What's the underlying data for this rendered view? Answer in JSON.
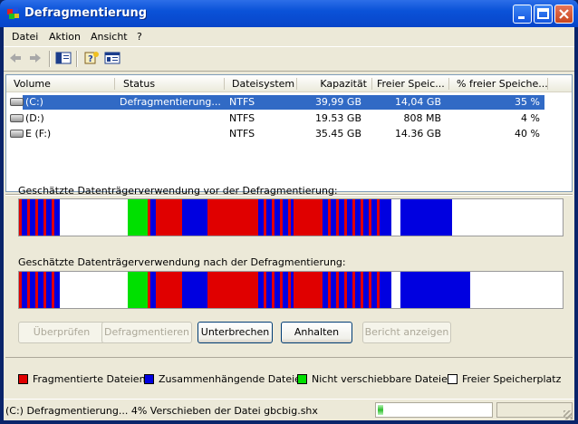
{
  "window": {
    "title": "Defragmentierung"
  },
  "menu": [
    "Datei",
    "Aktion",
    "Ansicht",
    "?"
  ],
  "volumes": {
    "headers": [
      "Volume",
      "Status",
      "Dateisystem",
      "Kapazität",
      "Freier Speic...",
      "% freier Speiche..."
    ],
    "rows": [
      {
        "volume": "(C:)",
        "status": "Defragmentierung...",
        "fs": "NTFS",
        "capacity": "39,99 GB",
        "free": "14,04 GB",
        "pct_free": "35 %",
        "selected": true
      },
      {
        "volume": "(D:)",
        "status": "",
        "fs": "NTFS",
        "capacity": "19.53 GB",
        "free": "808 MB",
        "pct_free": "4 %",
        "selected": false
      },
      {
        "volume": "E (F:)",
        "status": "",
        "fs": "NTFS",
        "capacity": "35.45 GB",
        "free": "14.36 GB",
        "pct_free": "40 %",
        "selected": false
      }
    ]
  },
  "analysis": {
    "before_label": "Geschätzte Datenträgerverwendung vor der Defragmentierung:",
    "after_label": "Geschätzte Datenträgerverwendung nach der Defragmentierung:",
    "before_segments": [
      {
        "start": 0.0,
        "end": 0.075,
        "kind": "mixed"
      },
      {
        "start": 0.075,
        "end": 0.2,
        "kind": "free"
      },
      {
        "start": 0.2,
        "end": 0.236,
        "kind": "unmovable"
      },
      {
        "start": 0.236,
        "end": 0.255,
        "kind": "mixed"
      },
      {
        "start": 0.255,
        "end": 0.3,
        "kind": "fragmented"
      },
      {
        "start": 0.3,
        "end": 0.347,
        "kind": "contiguous"
      },
      {
        "start": 0.347,
        "end": 0.435,
        "kind": "fragmented"
      },
      {
        "start": 0.435,
        "end": 0.505,
        "kind": "mixed"
      },
      {
        "start": 0.505,
        "end": 0.553,
        "kind": "fragmented"
      },
      {
        "start": 0.553,
        "end": 0.668,
        "kind": "mixed"
      },
      {
        "start": 0.668,
        "end": 0.685,
        "kind": "contiguous"
      },
      {
        "start": 0.685,
        "end": 0.702,
        "kind": "free"
      },
      {
        "start": 0.702,
        "end": 0.797,
        "kind": "contiguous"
      },
      {
        "start": 0.797,
        "end": 1.0,
        "kind": "free"
      }
    ],
    "after_segments": [
      {
        "start": 0.0,
        "end": 0.075,
        "kind": "mixed"
      },
      {
        "start": 0.075,
        "end": 0.2,
        "kind": "free"
      },
      {
        "start": 0.2,
        "end": 0.236,
        "kind": "unmovable"
      },
      {
        "start": 0.236,
        "end": 0.255,
        "kind": "mixed"
      },
      {
        "start": 0.255,
        "end": 0.3,
        "kind": "fragmented"
      },
      {
        "start": 0.3,
        "end": 0.347,
        "kind": "contiguous"
      },
      {
        "start": 0.347,
        "end": 0.435,
        "kind": "fragmented"
      },
      {
        "start": 0.435,
        "end": 0.505,
        "kind": "mixed"
      },
      {
        "start": 0.505,
        "end": 0.553,
        "kind": "fragmented"
      },
      {
        "start": 0.553,
        "end": 0.668,
        "kind": "mixed"
      },
      {
        "start": 0.668,
        "end": 0.685,
        "kind": "contiguous"
      },
      {
        "start": 0.685,
        "end": 0.702,
        "kind": "free"
      },
      {
        "start": 0.702,
        "end": 0.83,
        "kind": "contiguous"
      },
      {
        "start": 0.83,
        "end": 1.0,
        "kind": "free"
      }
    ]
  },
  "buttons": [
    {
      "label": "Überprüfen",
      "enabled": false
    },
    {
      "label": "Defragmentieren",
      "enabled": false
    },
    {
      "label": "Unterbrechen",
      "enabled": true
    },
    {
      "label": "Anhalten",
      "enabled": true
    },
    {
      "label": "Bericht anzeigen",
      "enabled": false
    }
  ],
  "legend": [
    {
      "label": "Fragmentierte Dateien",
      "color": "#e00000"
    },
    {
      "label": "Zusammenhängende Dateien",
      "color": "#0000e0"
    },
    {
      "label": "Nicht verschiebbare Dateien",
      "color": "#00e000"
    },
    {
      "label": "Freier Speicherplatz",
      "color": "#ffffff"
    }
  ],
  "status": {
    "text": "(C:) Defragmentierung... 4%  Verschieben der Datei gbcbig.shx",
    "progress": 0.04
  }
}
